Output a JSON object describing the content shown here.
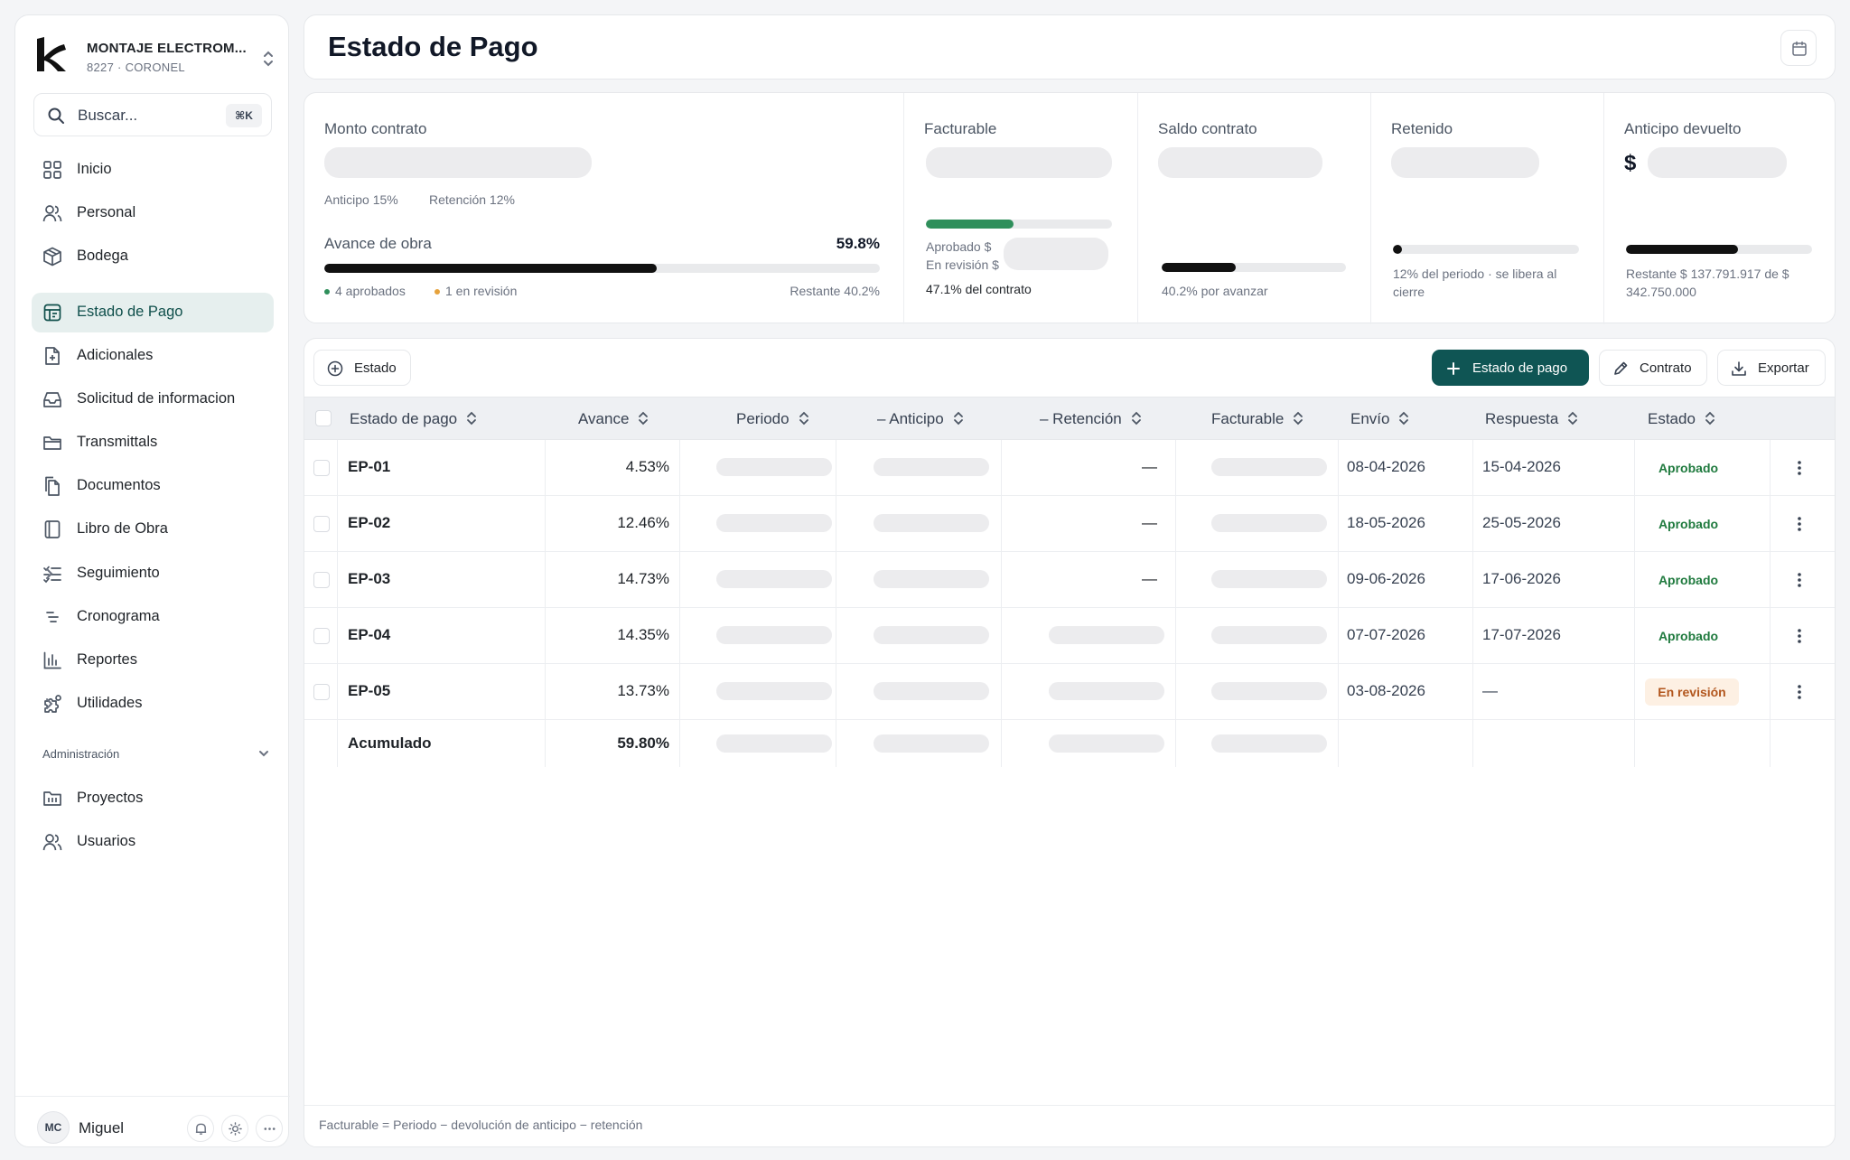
{
  "brand": {
    "name": "MONTAJE ELECTROM...",
    "sub": "8227 · CORONEL"
  },
  "search": {
    "label": "Buscar...",
    "shortcut": "⌘K"
  },
  "nav": [
    {
      "label": "Inicio",
      "icon": "grid-icon"
    },
    {
      "label": "Personal",
      "icon": "users-icon"
    },
    {
      "label": "Bodega",
      "icon": "box-icon"
    },
    {
      "label": "Estado de Pago",
      "icon": "receipt-icon",
      "active": true
    },
    {
      "label": "Adicionales",
      "icon": "file-plus-icon"
    },
    {
      "label": "Solicitud de informacion",
      "icon": "inbox-icon"
    },
    {
      "label": "Transmittals",
      "icon": "folder-icon"
    },
    {
      "label": "Documentos",
      "icon": "documents-icon"
    },
    {
      "label": "Libro de Obra",
      "icon": "book-icon"
    },
    {
      "label": "Seguimiento",
      "icon": "list-check-icon",
      "submenu": true
    },
    {
      "label": "Cronograma",
      "icon": "timeline-icon"
    },
    {
      "label": "Reportes",
      "icon": "chart-icon"
    },
    {
      "label": "Utilidades",
      "icon": "puzzle-icon",
      "submenu": true
    }
  ],
  "admin": {
    "label": "Administración",
    "items": [
      {
        "label": "Proyectos",
        "icon": "projects-icon"
      },
      {
        "label": "Usuarios",
        "icon": "users-icon"
      }
    ]
  },
  "user": {
    "initials": "MC",
    "name": "Miguel"
  },
  "header": {
    "title": "Estado de Pago"
  },
  "stats": {
    "monto": {
      "label": "Monto contrato",
      "anticipo": "Anticipo 15%",
      "retencion": "Retención 12%"
    },
    "avance": {
      "label": "Avance de obra",
      "value": "59.8%",
      "progress": 0.598,
      "aprobados": "4 aprobados",
      "revision": "1 en revisión",
      "restante": "Restante 40.2%"
    },
    "facturable": {
      "label": "Facturable",
      "progress": 0.471,
      "aprobado": "Aprobado $",
      "en_revision": "En revisión $",
      "note": "47.1% del contrato"
    },
    "saldo": {
      "label": "Saldo contrato",
      "progress": 0.402,
      "note": "40.2% por avanzar"
    },
    "retenido": {
      "label": "Retenido",
      "progress": 0.05,
      "note": "12% del periodo · se libera al cierre"
    },
    "anticipo": {
      "label": "Anticipo devuelto",
      "currency": "$",
      "progress": 0.6,
      "note": "Restante $ 137.791.917 de $ 342.750.000"
    }
  },
  "toolbar": {
    "filter": "Estado",
    "new": "Estado de pago",
    "contract": "Contrato",
    "export": "Exportar"
  },
  "columns": {
    "estado_pago": "Estado de pago",
    "avance": "Avance",
    "periodo": "Periodo",
    "anticipo": "– Anticipo",
    "retencion": "– Retención",
    "facturable": "Facturable",
    "envio": "Envío",
    "respuesta": "Respuesta",
    "estado": "Estado"
  },
  "rows": [
    {
      "ep": "EP-01",
      "avance": "4.53%",
      "retencion": "—",
      "envio": "08-04-2026",
      "respuesta": "15-04-2026",
      "estado": "Aprobado"
    },
    {
      "ep": "EP-02",
      "avance": "12.46%",
      "retencion": "—",
      "envio": "18-05-2026",
      "respuesta": "25-05-2026",
      "estado": "Aprobado"
    },
    {
      "ep": "EP-03",
      "avance": "14.73%",
      "retencion": "—",
      "envio": "09-06-2026",
      "respuesta": "17-06-2026",
      "estado": "Aprobado"
    },
    {
      "ep": "EP-04",
      "avance": "14.35%",
      "retencion": "",
      "envio": "07-07-2026",
      "respuesta": "17-07-2026",
      "estado": "Aprobado"
    },
    {
      "ep": "EP-05",
      "avance": "13.73%",
      "retencion": "",
      "envio": "03-08-2026",
      "respuesta": "—",
      "estado": "En revisión"
    }
  ],
  "total": {
    "label": "Acumulado",
    "avance": "59.80%"
  },
  "footer": {
    "note": "Facturable = Periodo − devolución de anticipo − retención"
  },
  "colors": {
    "accent": "#0f5554",
    "approved": "#1f7a3e",
    "review": "#b2561d",
    "green_bar": "#2f8f5b",
    "dark_bar": "#111111"
  }
}
